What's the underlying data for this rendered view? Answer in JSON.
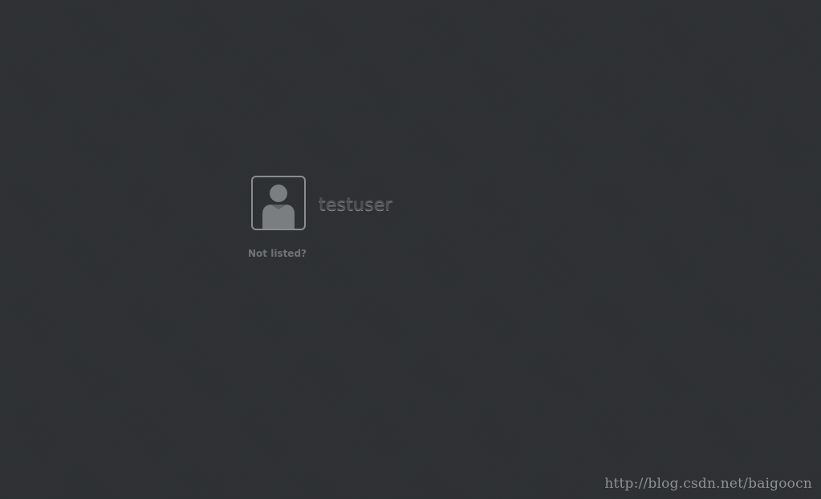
{
  "user_list": {
    "users": [
      {
        "username": "testuser",
        "avatar_icon": "default-user-icon"
      }
    ],
    "not_listed_label": "Not listed?"
  },
  "watermark": {
    "text": "http://blog.csdn.net/baigoocn"
  },
  "colors": {
    "background": "#2e3134",
    "avatar_border": "#8a8d90",
    "avatar_figure": "#7b7e81",
    "not_listed_text": "#6f7275"
  }
}
